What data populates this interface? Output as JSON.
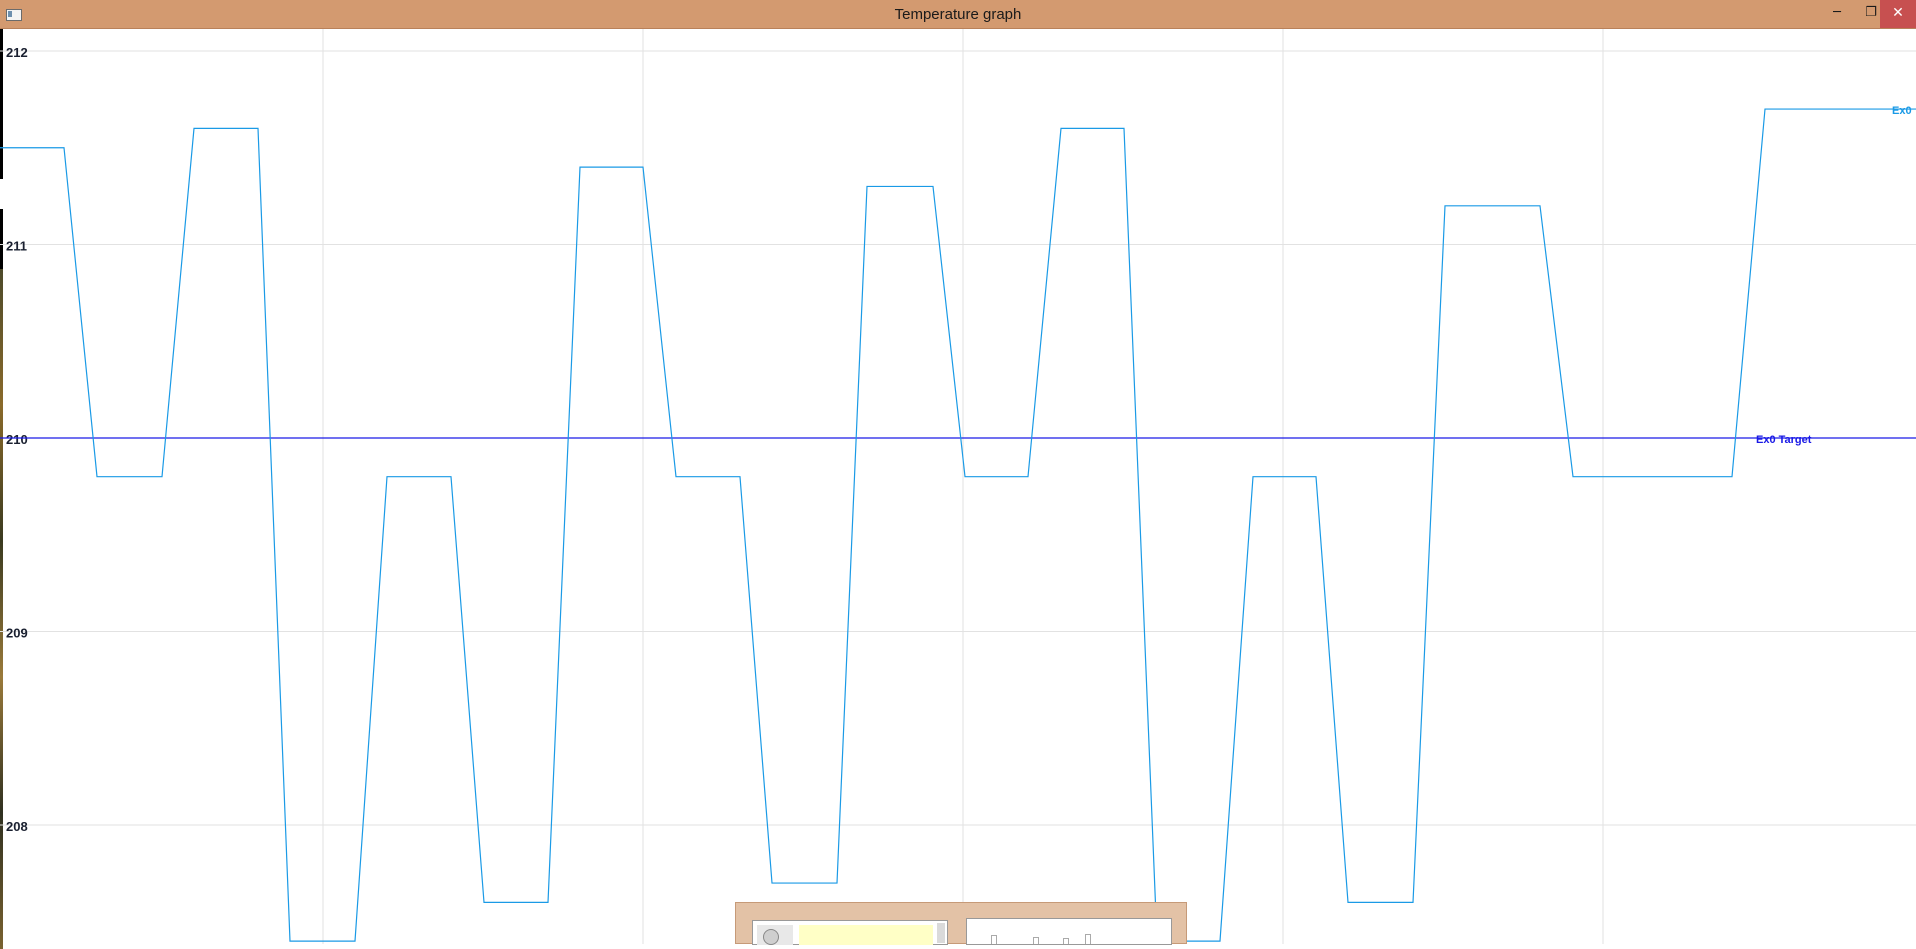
{
  "window": {
    "title": "Temperature graph",
    "minimize_glyph": "─",
    "maximize_glyph": "❐",
    "close_glyph": "✕"
  },
  "chart_data": {
    "type": "line",
    "ylim": [
      207.4,
      212.2
    ],
    "yticks": [
      "212",
      "211",
      "210",
      "209",
      "208"
    ],
    "grid": true,
    "series": [
      {
        "name": "Ex0",
        "color": "#1a9ae6",
        "values": [
          [
            0,
            211.5
          ],
          [
            64,
            211.5
          ],
          [
            97,
            209.8
          ],
          [
            162,
            209.8
          ],
          [
            194,
            211.6
          ],
          [
            258,
            211.6
          ],
          [
            290,
            207.4
          ],
          [
            355,
            207.4
          ],
          [
            387,
            209.8
          ],
          [
            451,
            209.8
          ],
          [
            484,
            207.6
          ],
          [
            548,
            207.6
          ],
          [
            580,
            211.4
          ],
          [
            643,
            211.4
          ],
          [
            676,
            209.8
          ],
          [
            740,
            209.8
          ],
          [
            772,
            207.7
          ],
          [
            837,
            207.7
          ],
          [
            867,
            211.3
          ],
          [
            933,
            211.3
          ],
          [
            965,
            209.8
          ],
          [
            1028,
            209.8
          ],
          [
            1061,
            211.6
          ],
          [
            1124,
            211.6
          ],
          [
            1157,
            207.4
          ],
          [
            1220,
            207.4
          ],
          [
            1253,
            209.8
          ],
          [
            1316,
            209.8
          ],
          [
            1348,
            207.6
          ],
          [
            1413,
            207.6
          ],
          [
            1445,
            211.2
          ],
          [
            1540,
            211.2
          ],
          [
            1573,
            209.8
          ],
          [
            1732,
            209.8
          ],
          [
            1765,
            211.7
          ],
          [
            1916,
            211.7
          ]
        ]
      },
      {
        "name": "Ex0 Target",
        "color": "#1a1ae6",
        "values": [
          [
            0,
            210
          ],
          [
            1916,
            210
          ]
        ]
      }
    ]
  }
}
